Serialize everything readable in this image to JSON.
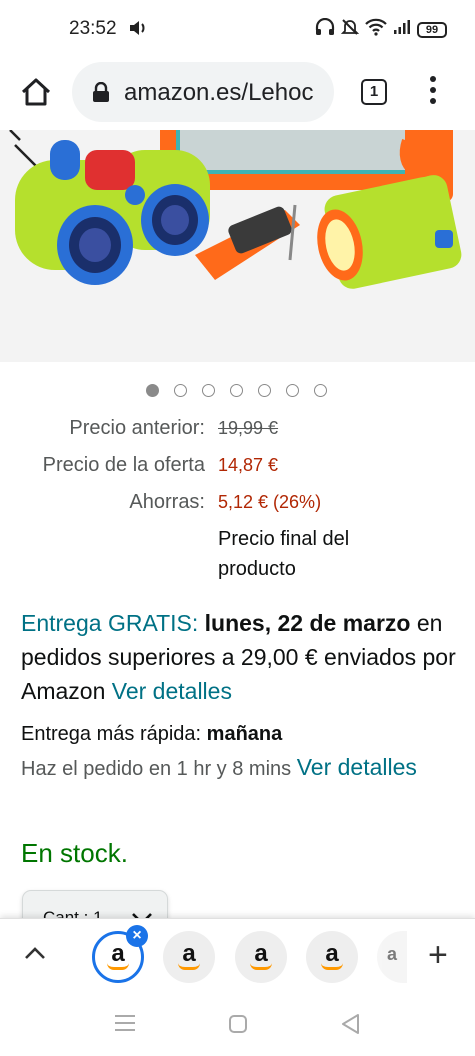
{
  "status_bar": {
    "time": "23:52",
    "battery": "99",
    "icons": [
      "sound-icon",
      "headphones-icon",
      "mute-icon",
      "wifi-icon",
      "signal-icon",
      "battery-icon"
    ]
  },
  "browser": {
    "url": "amazon.es/Lehoc",
    "tab_count": "1",
    "icons": [
      "home-icon",
      "lock-icon",
      "tabs-icon",
      "overflow-menu-icon"
    ]
  },
  "carousel": {
    "dot_count": 7,
    "active_index": 0
  },
  "price": {
    "previous_label": "Precio anterior:",
    "previous_value": "19,99 €",
    "deal_label": "Precio de la oferta",
    "deal_value": "14,87 €",
    "savings_label": "Ahorras:",
    "savings_value": "5,12 € (26%)",
    "final_note": "Precio final del producto"
  },
  "delivery": {
    "free_label": "Entrega GRATIS:",
    "date": "lunes, 22 de marzo",
    "condition": "en pedidos superiores a 29,00 € enviados por Amazon",
    "details_link": "Ver detalles",
    "faster_label": "Entrega más rápida:",
    "faster_date": "mañana",
    "order_within": "Haz el pedido en 1 hr y 8 mins",
    "faster_details_link": "Ver detalles"
  },
  "stock": {
    "status": "En stock."
  },
  "quantity": {
    "label": "Cant.: 1"
  },
  "tab_strip": {
    "tab_letter": "a",
    "close_glyph": "×",
    "add_glyph": "+"
  },
  "colors": {
    "link": "#007185",
    "price_red": "#b12704",
    "stock_green": "#007600",
    "active_tab": "#1a73e8",
    "amazon_orange": "#ff9900"
  }
}
